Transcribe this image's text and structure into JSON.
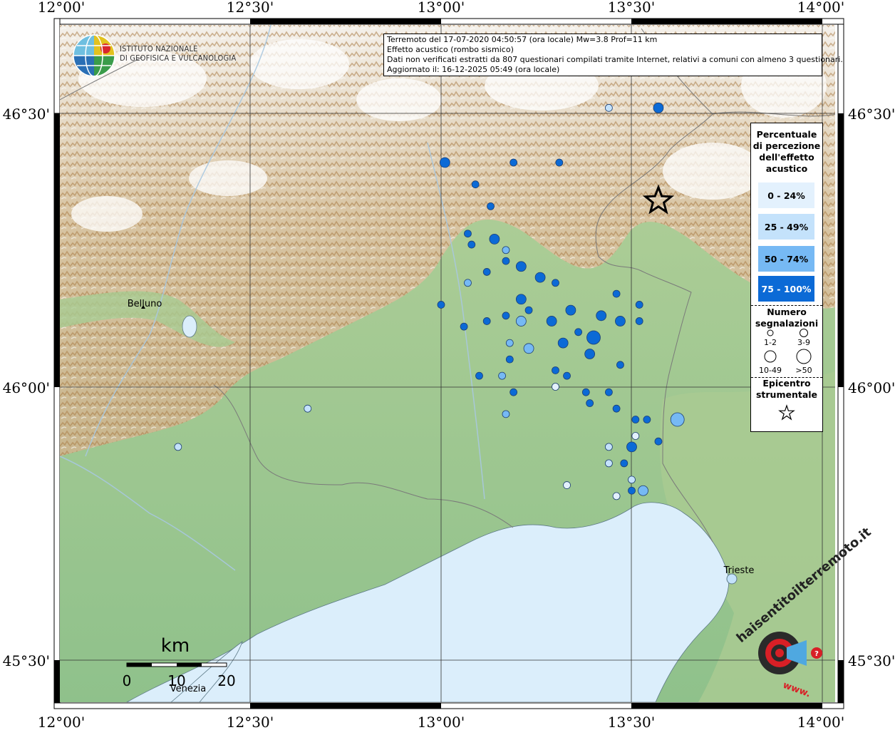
{
  "header": {
    "line1": "Terremoto del 17-07-2020 04:50:57 (ora locale) Mw=3.8 Prof=11 km",
    "line2": "Effetto acustico (rombo sismico)",
    "line3": "Dati non verificati estratti da 807 questionari compilati tramite Internet, relativi a comuni con almeno 3 questionari.",
    "line4": "Aggiornato il: 16-12-2025 05:49 (ora locale)"
  },
  "institute": {
    "line1": "ISTITUTO NAZIONALE",
    "line2": "DI GEOFISICA E VULCANOLOGIA"
  },
  "axes": {
    "lon_labels": [
      "12°00'",
      "12°30'",
      "13°00'",
      "13°30'",
      "14°00'"
    ],
    "lat_labels": [
      "46°30'",
      "46°00'",
      "45°30'"
    ]
  },
  "places": {
    "belluno": "Belluno",
    "trieste": "Trieste",
    "venezia": "Venezia"
  },
  "scalebar": {
    "unit": "km",
    "ticks": [
      "0",
      "10",
      "20"
    ]
  },
  "legend": {
    "title": [
      "Percentuale",
      "di percezione",
      "dell'effetto",
      "acustico"
    ],
    "classes": [
      {
        "label": "0 - 24%",
        "color": "#e3f1fd"
      },
      {
        "label": "25 - 49%",
        "color": "#c4e2fb"
      },
      {
        "label": "50 - 74%",
        "color": "#76b9f4"
      },
      {
        "label": "75 - 100%",
        "color": "#0b6ad6"
      }
    ],
    "count_title": [
      "Numero",
      "segnalazioni"
    ],
    "count_classes": [
      "1-2",
      "3-9",
      "10-49",
      ">50"
    ],
    "epicenter_title": [
      "Epicentro",
      "strumentale"
    ]
  },
  "watermark": {
    "text": "haisentitoilterremoto.it",
    "url": "www."
  },
  "colors": {
    "sea": "#dbeefb",
    "plain": "#97c591",
    "class1": "#e3f1fd",
    "class2": "#c4e2fb",
    "class3": "#76b9f4",
    "class4": "#0b6ad6"
  },
  "chart_data": {
    "type": "map",
    "epicenter": {
      "lon": 13.57,
      "lat": 46.34
    },
    "points": [
      {
        "lon": 13.01,
        "lat": 46.41,
        "cls": 4,
        "size": 2
      },
      {
        "lon": 13.19,
        "lat": 46.41,
        "cls": 4,
        "size": 1
      },
      {
        "lon": 13.31,
        "lat": 46.41,
        "cls": 4,
        "size": 1
      },
      {
        "lon": 13.44,
        "lat": 46.51,
        "cls": 2,
        "size": 1
      },
      {
        "lon": 13.57,
        "lat": 46.51,
        "cls": 4,
        "size": 2
      },
      {
        "lon": 13.09,
        "lat": 46.37,
        "cls": 4,
        "size": 1
      },
      {
        "lon": 13.13,
        "lat": 46.33,
        "cls": 4,
        "size": 1
      },
      {
        "lon": 13.07,
        "lat": 46.28,
        "cls": 4,
        "size": 1
      },
      {
        "lon": 13.14,
        "lat": 46.27,
        "cls": 4,
        "size": 2
      },
      {
        "lon": 13.08,
        "lat": 46.26,
        "cls": 4,
        "size": 1
      },
      {
        "lon": 13.17,
        "lat": 46.25,
        "cls": 3,
        "size": 1
      },
      {
        "lon": 13.17,
        "lat": 46.23,
        "cls": 4,
        "size": 1
      },
      {
        "lon": 13.21,
        "lat": 46.22,
        "cls": 4,
        "size": 2
      },
      {
        "lon": 13.12,
        "lat": 46.21,
        "cls": 4,
        "size": 1
      },
      {
        "lon": 13.26,
        "lat": 46.2,
        "cls": 4,
        "size": 2
      },
      {
        "lon": 13.3,
        "lat": 46.19,
        "cls": 4,
        "size": 1
      },
      {
        "lon": 13.07,
        "lat": 46.19,
        "cls": 3,
        "size": 1
      },
      {
        "lon": 13.21,
        "lat": 46.16,
        "cls": 4,
        "size": 2
      },
      {
        "lon": 13.46,
        "lat": 46.17,
        "cls": 4,
        "size": 1
      },
      {
        "lon": 13.52,
        "lat": 46.15,
        "cls": 4,
        "size": 1
      },
      {
        "lon": 13.0,
        "lat": 46.15,
        "cls": 4,
        "size": 1
      },
      {
        "lon": 13.23,
        "lat": 46.14,
        "cls": 4,
        "size": 1
      },
      {
        "lon": 13.34,
        "lat": 46.14,
        "cls": 4,
        "size": 2
      },
      {
        "lon": 13.17,
        "lat": 46.13,
        "cls": 4,
        "size": 1
      },
      {
        "lon": 13.21,
        "lat": 46.12,
        "cls": 3,
        "size": 2
      },
      {
        "lon": 13.42,
        "lat": 46.13,
        "cls": 4,
        "size": 2
      },
      {
        "lon": 13.47,
        "lat": 46.12,
        "cls": 4,
        "size": 2
      },
      {
        "lon": 13.29,
        "lat": 46.12,
        "cls": 4,
        "size": 2
      },
      {
        "lon": 13.52,
        "lat": 46.12,
        "cls": 4,
        "size": 1
      },
      {
        "lon": 13.06,
        "lat": 46.11,
        "cls": 4,
        "size": 1
      },
      {
        "lon": 13.12,
        "lat": 46.12,
        "cls": 4,
        "size": 1
      },
      {
        "lon": 13.4,
        "lat": 46.09,
        "cls": 4,
        "size": 3
      },
      {
        "lon": 13.36,
        "lat": 46.1,
        "cls": 4,
        "size": 1
      },
      {
        "lon": 13.32,
        "lat": 46.08,
        "cls": 4,
        "size": 2
      },
      {
        "lon": 13.18,
        "lat": 46.08,
        "cls": 3,
        "size": 1
      },
      {
        "lon": 13.23,
        "lat": 46.07,
        "cls": 3,
        "size": 2
      },
      {
        "lon": 13.39,
        "lat": 46.06,
        "cls": 4,
        "size": 2
      },
      {
        "lon": 13.18,
        "lat": 46.05,
        "cls": 4,
        "size": 1
      },
      {
        "lon": 13.47,
        "lat": 46.04,
        "cls": 4,
        "size": 1
      },
      {
        "lon": 13.3,
        "lat": 46.03,
        "cls": 4,
        "size": 1
      },
      {
        "lon": 13.33,
        "lat": 46.02,
        "cls": 4,
        "size": 1
      },
      {
        "lon": 13.1,
        "lat": 46.02,
        "cls": 4,
        "size": 1
      },
      {
        "lon": 13.16,
        "lat": 46.02,
        "cls": 3,
        "size": 1
      },
      {
        "lon": 13.3,
        "lat": 46.0,
        "cls": 1,
        "size": 1
      },
      {
        "lon": 13.44,
        "lat": 45.99,
        "cls": 4,
        "size": 1
      },
      {
        "lon": 13.19,
        "lat": 45.99,
        "cls": 4,
        "size": 1
      },
      {
        "lon": 13.38,
        "lat": 45.99,
        "cls": 4,
        "size": 1
      },
      {
        "lon": 13.39,
        "lat": 45.97,
        "cls": 4,
        "size": 1
      },
      {
        "lon": 13.46,
        "lat": 45.96,
        "cls": 4,
        "size": 1
      },
      {
        "lon": 12.65,
        "lat": 45.96,
        "cls": 2,
        "size": 1
      },
      {
        "lon": 13.17,
        "lat": 45.95,
        "cls": 3,
        "size": 1
      },
      {
        "lon": 13.51,
        "lat": 45.94,
        "cls": 4,
        "size": 1
      },
      {
        "lon": 13.54,
        "lat": 45.94,
        "cls": 4,
        "size": 1
      },
      {
        "lon": 13.62,
        "lat": 45.94,
        "cls": 3,
        "size": 3
      },
      {
        "lon": 13.51,
        "lat": 45.91,
        "cls": 1,
        "size": 1
      },
      {
        "lon": 13.57,
        "lat": 45.9,
        "cls": 4,
        "size": 1
      },
      {
        "lon": 13.5,
        "lat": 45.89,
        "cls": 4,
        "size": 2
      },
      {
        "lon": 13.44,
        "lat": 45.89,
        "cls": 2,
        "size": 1
      },
      {
        "lon": 12.31,
        "lat": 45.89,
        "cls": 2,
        "size": 1
      },
      {
        "lon": 13.48,
        "lat": 45.86,
        "cls": 4,
        "size": 1
      },
      {
        "lon": 13.44,
        "lat": 45.86,
        "cls": 2,
        "size": 1
      },
      {
        "lon": 13.5,
        "lat": 45.83,
        "cls": 2,
        "size": 1
      },
      {
        "lon": 13.33,
        "lat": 45.82,
        "cls": 1,
        "size": 1
      },
      {
        "lon": 13.5,
        "lat": 45.81,
        "cls": 4,
        "size": 1
      },
      {
        "lon": 13.53,
        "lat": 45.81,
        "cls": 3,
        "size": 2
      },
      {
        "lon": 13.46,
        "lat": 45.8,
        "cls": 1,
        "size": 1
      }
    ]
  }
}
